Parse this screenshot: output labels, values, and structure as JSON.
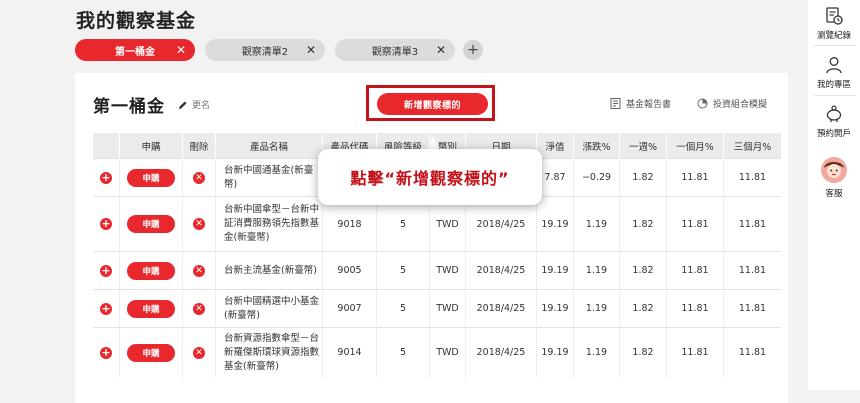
{
  "page": {
    "title": "我的觀察基金"
  },
  "tabs": [
    {
      "label": "第一桶金",
      "active": true
    },
    {
      "label": "觀察清單2",
      "active": false
    },
    {
      "label": "觀察清單3",
      "active": false
    }
  ],
  "tab_close_glyph": "✕",
  "tab_add_glyph": "+",
  "watchlist": {
    "name": "第一桶金",
    "rename_label": "更名",
    "add_target_label": "新增觀察標的",
    "report_label": "基金報告書",
    "simulate_label": "投資組合模擬"
  },
  "table": {
    "headers": [
      "申購",
      "刪除",
      "產品名稱",
      "產品代碼",
      "風險等級",
      "幣別",
      "日期",
      "淨值",
      "漲跌%",
      "一週%",
      "一個月%",
      "三個月%"
    ],
    "buy_label": "申購",
    "rows": [
      {
        "name": "台新中國通基金(新臺幣)",
        "code": "",
        "risk": "",
        "currency": "",
        "date": "",
        "nav": "7.87",
        "change": "−0.29",
        "week": "1.82",
        "month": "11.81",
        "quarter": "11.81"
      },
      {
        "name": "台新中國傘型－台新中証消費服務領先指數基金(新臺幣)",
        "code": "9018",
        "risk": "5",
        "currency": "TWD",
        "date": "2018/4/25",
        "nav": "19.19",
        "change": "1.19",
        "week": "1.82",
        "month": "11.81",
        "quarter": "11.81"
      },
      {
        "name": "台新主流基金(新臺幣)",
        "code": "9005",
        "risk": "5",
        "currency": "TWD",
        "date": "2018/4/25",
        "nav": "19.19",
        "change": "1.19",
        "week": "1.82",
        "month": "11.81",
        "quarter": "11.81"
      },
      {
        "name": "台新中國精選中小基金(新臺幣)",
        "code": "9007",
        "risk": "5",
        "currency": "TWD",
        "date": "2018/4/25",
        "nav": "19.19",
        "change": "1.19",
        "week": "1.82",
        "month": "11.81",
        "quarter": "11.81"
      },
      {
        "name": "台新資源指數傘型－台新羅傑斯環球資源指數基金(新臺幣)",
        "code": "9014",
        "risk": "5",
        "currency": "TWD",
        "date": "2018/4/25",
        "nav": "19.19",
        "change": "1.19",
        "week": "1.82",
        "month": "11.81",
        "quarter": "11.81"
      }
    ]
  },
  "callout": {
    "text": "點擊“新增觀察標的”"
  },
  "right_rail": {
    "browse_history": "瀏覽紀錄",
    "my_area": "我的專區",
    "appointment": "預約開戶",
    "service": "客服"
  },
  "colors": {
    "brand_red": "#e8282d",
    "frame_red": "#c4121a"
  }
}
